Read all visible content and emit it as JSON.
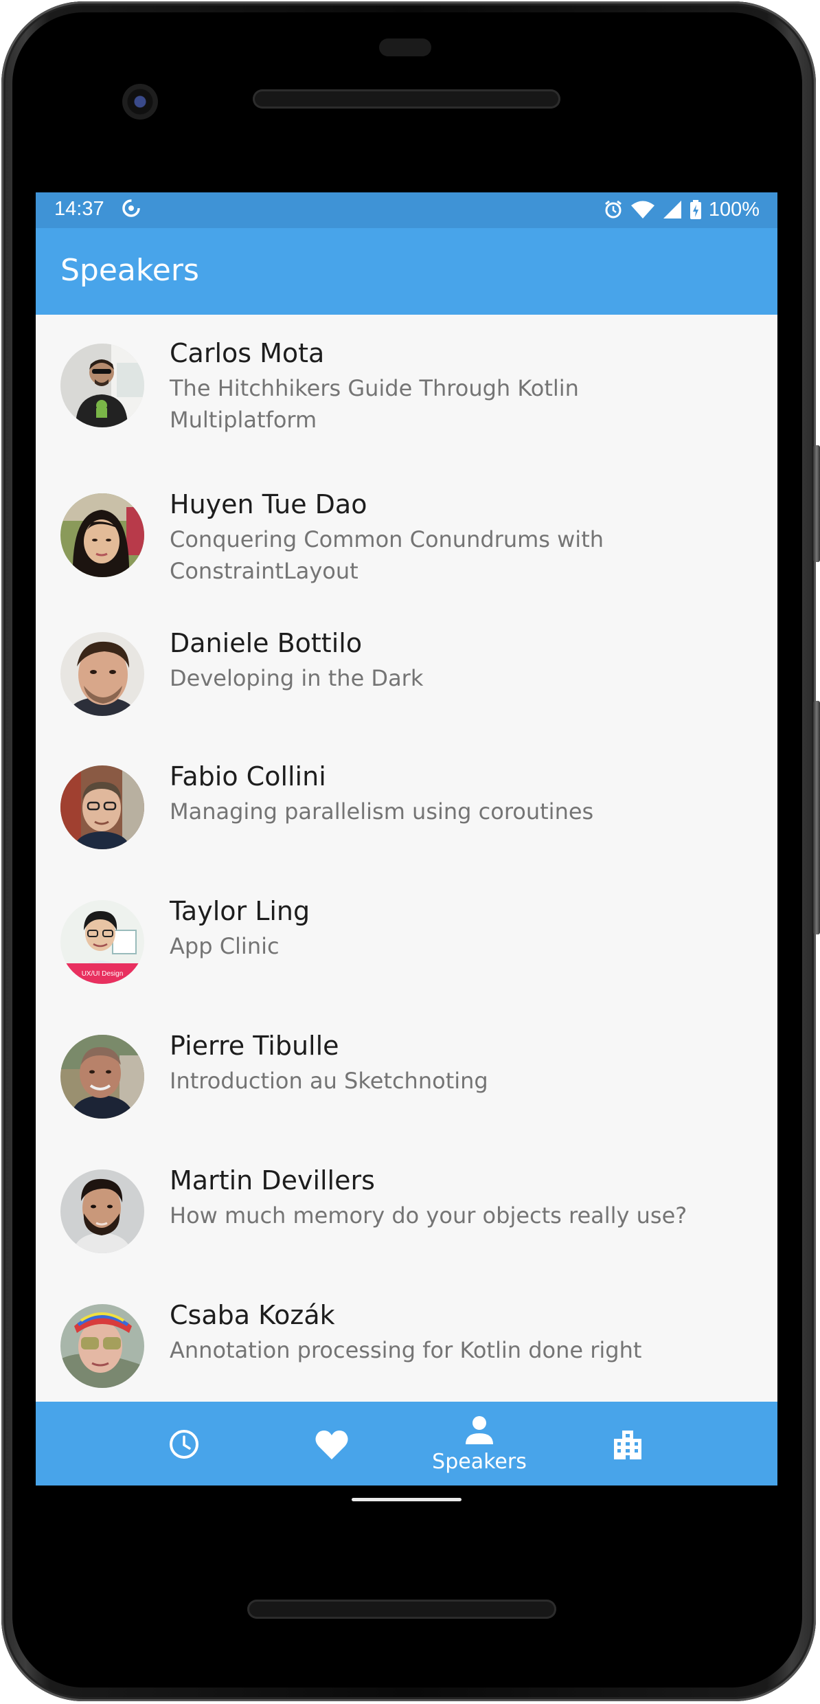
{
  "status_bar": {
    "time": "14:37",
    "battery": "100%",
    "icons": [
      "data-saver-icon",
      "alarm-icon",
      "wifi-icon",
      "signal-icon",
      "battery-charging-icon"
    ]
  },
  "app_bar": {
    "title": "Speakers"
  },
  "speakers": [
    {
      "name": "Carlos Mota",
      "talk": "The Hitchhikers Guide Through Kotlin Multiplatform"
    },
    {
      "name": "Huyen Tue Dao",
      "talk": "Conquering Common Conundrums with ConstraintLayout"
    },
    {
      "name": "Daniele Bottilo",
      "talk": "Developing in the Dark"
    },
    {
      "name": "Fabio Collini",
      "talk": "Managing parallelism using coroutines"
    },
    {
      "name": "Taylor Ling",
      "talk": "App Clinic",
      "avatar_caption": "UX/UI Design"
    },
    {
      "name": "Pierre Tibulle",
      "talk": "Introduction au Sketchnoting"
    },
    {
      "name": "Martin Devillers",
      "talk": "How much memory do your objects really use?"
    },
    {
      "name": "Csaba Kozák",
      "talk": "Annotation processing for Kotlin done right"
    }
  ],
  "bottom_nav": {
    "items": [
      {
        "icon": "clock-icon",
        "label": ""
      },
      {
        "icon": "heart-icon",
        "label": ""
      },
      {
        "icon": "person-icon",
        "label": "Speakers",
        "selected": true
      },
      {
        "icon": "building-icon",
        "label": ""
      }
    ]
  },
  "colors": {
    "app_bar": "#48a4ea",
    "status_bar": "#3f93d6",
    "list_background": "#f7f7f7"
  }
}
